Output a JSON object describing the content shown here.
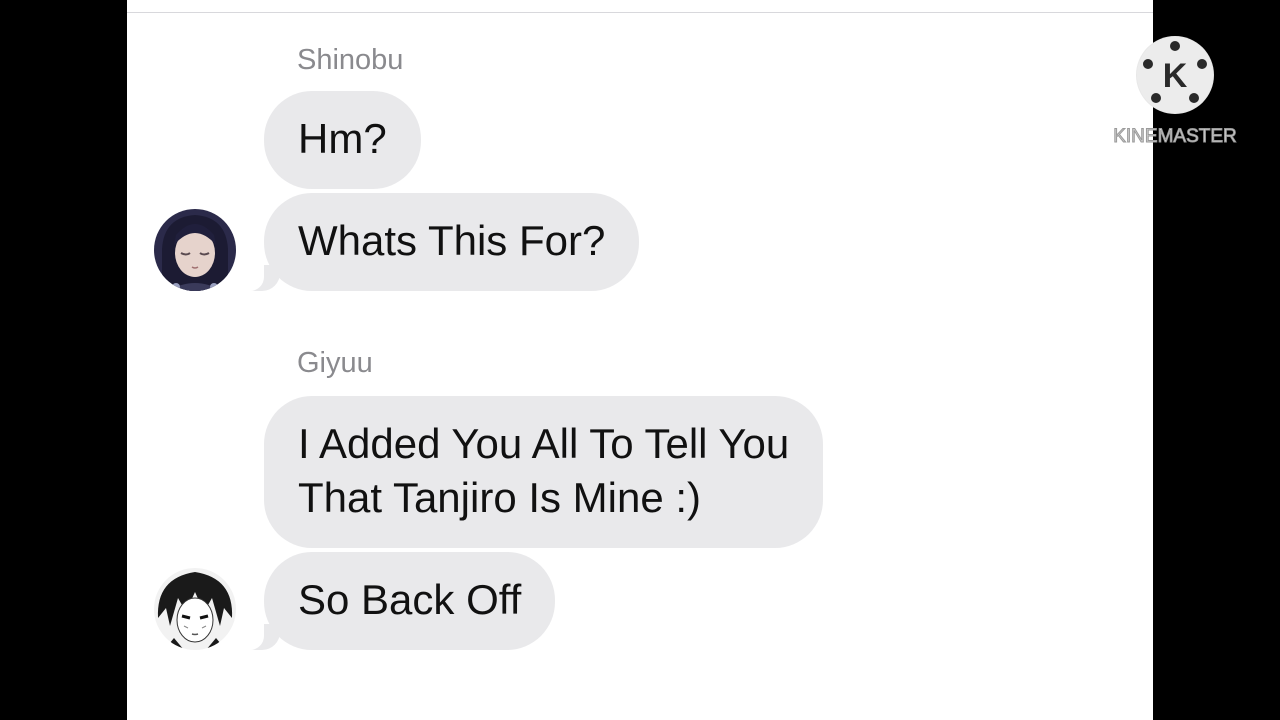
{
  "conversation": {
    "groups": [
      {
        "sender": "Shinobu",
        "avatar_icon": "shinobu-avatar-icon",
        "messages": [
          "Hm?",
          "Whats This For?"
        ]
      },
      {
        "sender": "Giyuu",
        "avatar_icon": "giyuu-avatar-icon",
        "messages": [
          "I Added You All To Tell You",
          "That Tanjiro Is Mine :)",
          "So Back Off"
        ]
      }
    ]
  },
  "watermark": {
    "logo_letter": "K",
    "text": "KINEMASTER"
  },
  "colors": {
    "bubble": "#e9e9eb",
    "sender_name": "#8a8a8e",
    "background": "#ffffff",
    "letterbox": "#000000"
  }
}
